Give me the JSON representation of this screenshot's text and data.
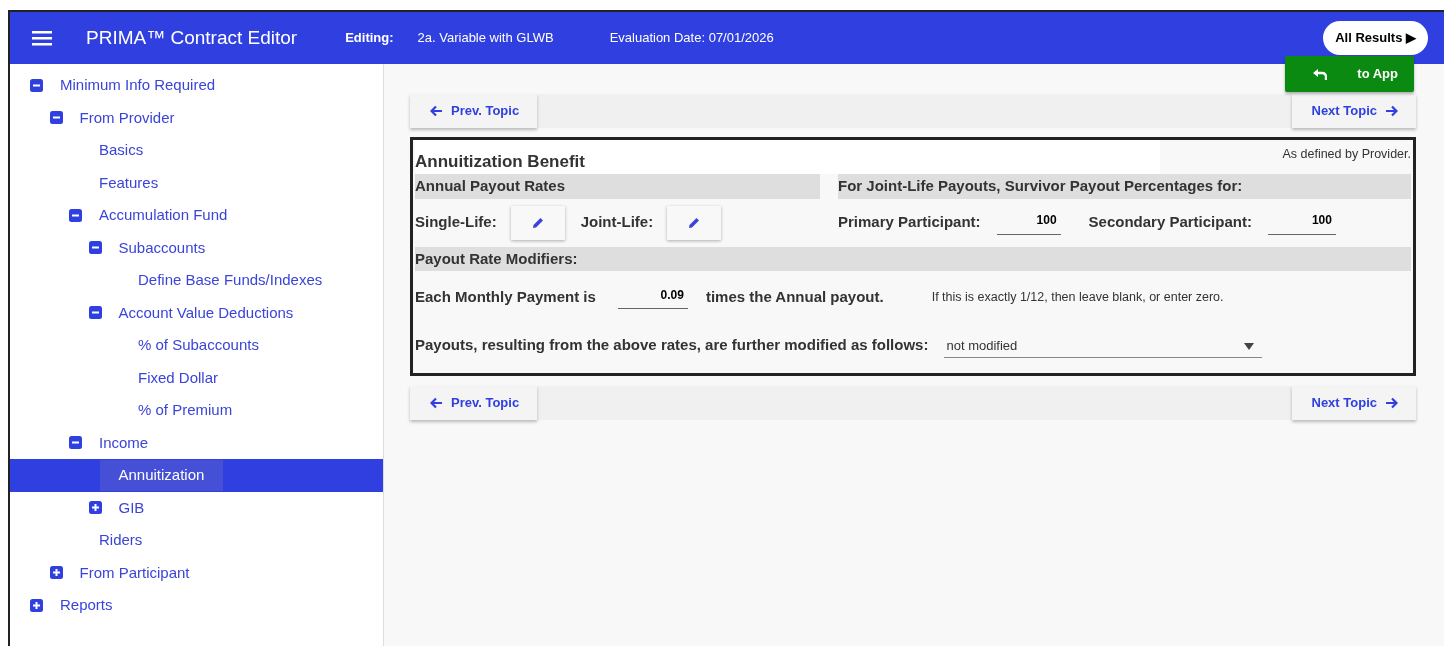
{
  "header": {
    "title": "PRIMA™ Contract Editor",
    "editing_label": "Editing:",
    "editing_value": "2a. Variable with GLWB",
    "evaluation_date": "Evaluation Date: 07/01/2026",
    "results_button": "All Results ▶"
  },
  "to_app_button": "to App",
  "tree": [
    {
      "label": "Minimum Info Required",
      "expanded": true,
      "selected": false,
      "children": [
        {
          "label": "From Provider",
          "expanded": true,
          "selected": false,
          "children": [
            {
              "label": "Basics",
              "selected": false
            },
            {
              "label": "Features",
              "selected": false
            },
            {
              "label": "Accumulation Fund",
              "expanded": true,
              "selected": false,
              "children": [
                {
                  "label": "Subaccounts",
                  "expanded": true,
                  "selected": false,
                  "children": [
                    {
                      "label": "Define Base Funds/Indexes",
                      "selected": false
                    }
                  ]
                },
                {
                  "label": "Account Value Deductions",
                  "expanded": true,
                  "selected": false,
                  "children": [
                    {
                      "label": "% of Subaccounts",
                      "selected": false
                    },
                    {
                      "label": "Fixed Dollar",
                      "selected": false
                    },
                    {
                      "label": "% of Premium",
                      "selected": false
                    }
                  ]
                }
              ]
            },
            {
              "label": "Income",
              "expanded": true,
              "selected": false,
              "children": [
                {
                  "label": "Annuitization",
                  "selected": true
                },
                {
                  "label": "GIB",
                  "expanded": false,
                  "selected": false
                }
              ]
            },
            {
              "label": "Riders",
              "selected": false
            }
          ]
        },
        {
          "label": "From Participant",
          "expanded": false,
          "selected": false
        }
      ]
    },
    {
      "label": "Reports",
      "expanded": false,
      "selected": false
    }
  ],
  "topic_nav_top": {
    "prev": "Prev. Topic",
    "next": "Next Topic"
  },
  "panel": {
    "title": "Annuitization Benefit",
    "note": "As defined by Provider.",
    "rates_heading": "Annual Payout Rates",
    "survivor_heading": "For Joint-Life Payouts, Survivor Payout Percentages for:",
    "single_life_label": "Single-Life:",
    "joint_life_label": "Joint-Life:",
    "primary_label": "Primary Participant:",
    "primary_value": "100",
    "secondary_label": "Secondary Participant:",
    "secondary_value": "100",
    "modifiers_heading": "Payout Rate Modifiers:",
    "monthly_label": "Each Monthly Payment is",
    "monthly_value": "0.09",
    "monthly_suffix": "times the Annual payout.",
    "monthly_hint": "If this is exactly 1/12, then leave blank, or enter zero.",
    "further_label": "Payouts, resulting from the above rates, are further modified as follows:",
    "further_value": "not modified"
  },
  "topic_nav_bottom": {
    "prev": "Prev. Topic",
    "next": "Next Topic"
  }
}
